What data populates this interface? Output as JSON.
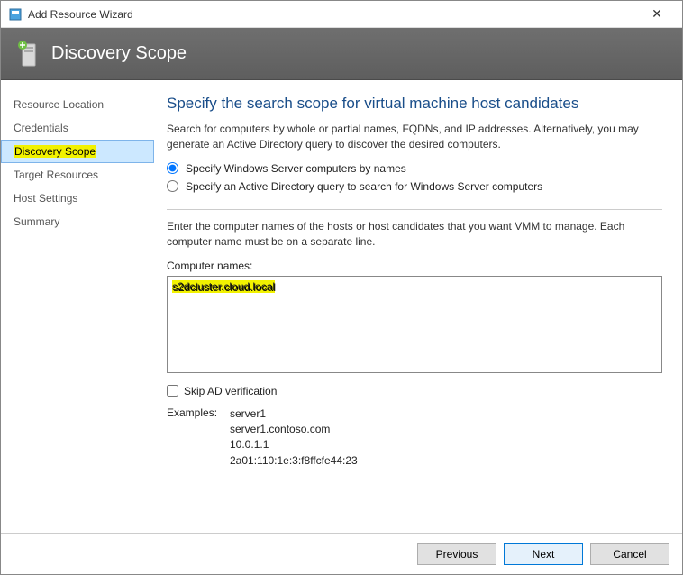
{
  "window": {
    "title": "Add Resource Wizard"
  },
  "header": {
    "title": "Discovery Scope"
  },
  "sidebar": {
    "steps": [
      {
        "label": "Resource Location"
      },
      {
        "label": "Credentials"
      },
      {
        "label": "Discovery Scope"
      },
      {
        "label": "Target Resources"
      },
      {
        "label": "Host Settings"
      },
      {
        "label": "Summary"
      }
    ]
  },
  "main": {
    "heading": "Specify the search scope for virtual machine host candidates",
    "intro": "Search for computers by whole or partial names, FQDNs, and IP addresses. Alternatively, you may generate an Active Directory query to discover the desired computers.",
    "radio1": "Specify Windows Server computers by names",
    "radio2": "Specify an Active Directory query to search for Windows Server computers",
    "instruction": "Enter the computer names of the hosts or host candidates that you want VMM to manage. Each computer name must be on a separate line.",
    "computers_label": "Computer names:",
    "computers_value": "s2dcluster.cloud.local",
    "skip_ad": "Skip AD verification",
    "examples_label": "Examples:",
    "examples": {
      "l1": "server1",
      "l2": "server1.contoso.com",
      "l3": "10.0.1.1",
      "l4": "2a01:110:1e:3:f8ffcfe44:23"
    }
  },
  "footer": {
    "previous": "Previous",
    "next": "Next",
    "cancel": "Cancel"
  }
}
